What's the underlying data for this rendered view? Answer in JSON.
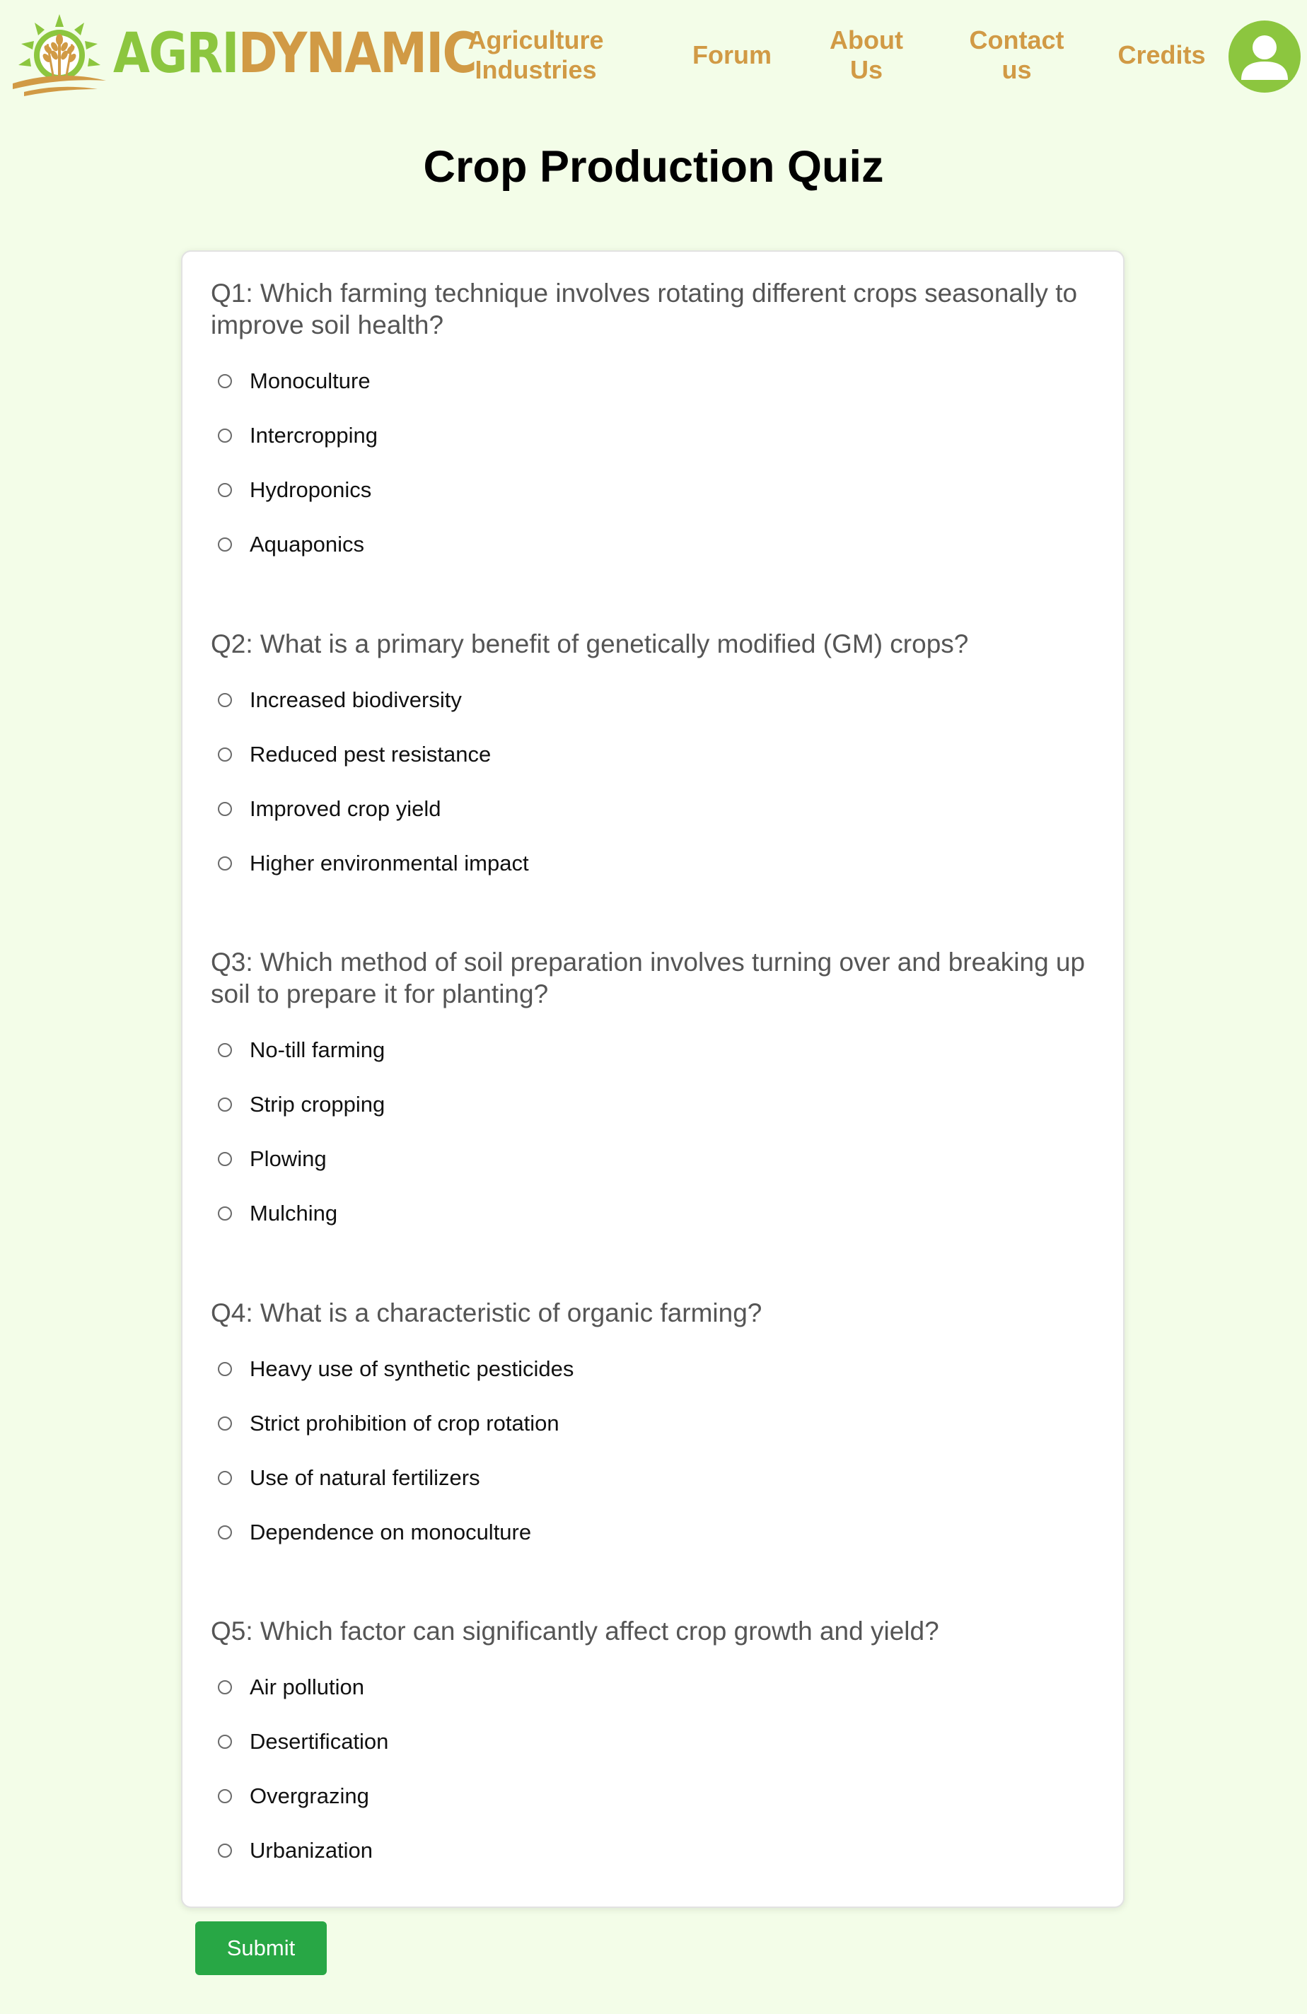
{
  "brand": {
    "name_part1": "AGRI",
    "name_part2": "DYNAMIC",
    "colors": {
      "green": "#8cc63f",
      "gold": "#d19a45"
    }
  },
  "nav": {
    "agriculture_line1": "Agriculture",
    "agriculture_line2": "Industries",
    "forum": "Forum",
    "about_line1": "About",
    "about_line2": "Us",
    "contact_line1": "Contact",
    "contact_line2": "us",
    "credits": "Credits"
  },
  "page": {
    "title": "Crop Production Quiz",
    "background": "#f3fde8"
  },
  "quiz": {
    "questions": [
      {
        "text": "Q1: Which farming technique involves rotating different crops seasonally to improve soil health?",
        "options": [
          "Monoculture",
          "Intercropping",
          "Hydroponics",
          "Aquaponics"
        ]
      },
      {
        "text": "Q2: What is a primary benefit of genetically modified (GM) crops?",
        "options": [
          "Increased biodiversity",
          "Reduced pest resistance",
          "Improved crop yield",
          "Higher environmental impact"
        ]
      },
      {
        "text": "Q3: Which method of soil preparation involves turning over and breaking up soil to prepare it for planting?",
        "options": [
          "No-till farming",
          "Strip cropping",
          "Plowing",
          "Mulching"
        ]
      },
      {
        "text": "Q4: What is a characteristic of organic farming?",
        "options": [
          "Heavy use of synthetic pesticides",
          "Strict prohibition of crop rotation",
          "Use of natural fertilizers",
          "Dependence on monoculture"
        ]
      },
      {
        "text": "Q5: Which factor can significantly affect crop growth and yield?",
        "options": [
          "Air pollution",
          "Desertification",
          "Overgrazing",
          "Urbanization"
        ]
      }
    ],
    "submit_label": "Submit",
    "submit_color": "#28a745"
  },
  "icons": {
    "logo": "wheat-sun-logo-icon",
    "profile": "user-profile-icon",
    "radio": "radio-button-icon"
  }
}
